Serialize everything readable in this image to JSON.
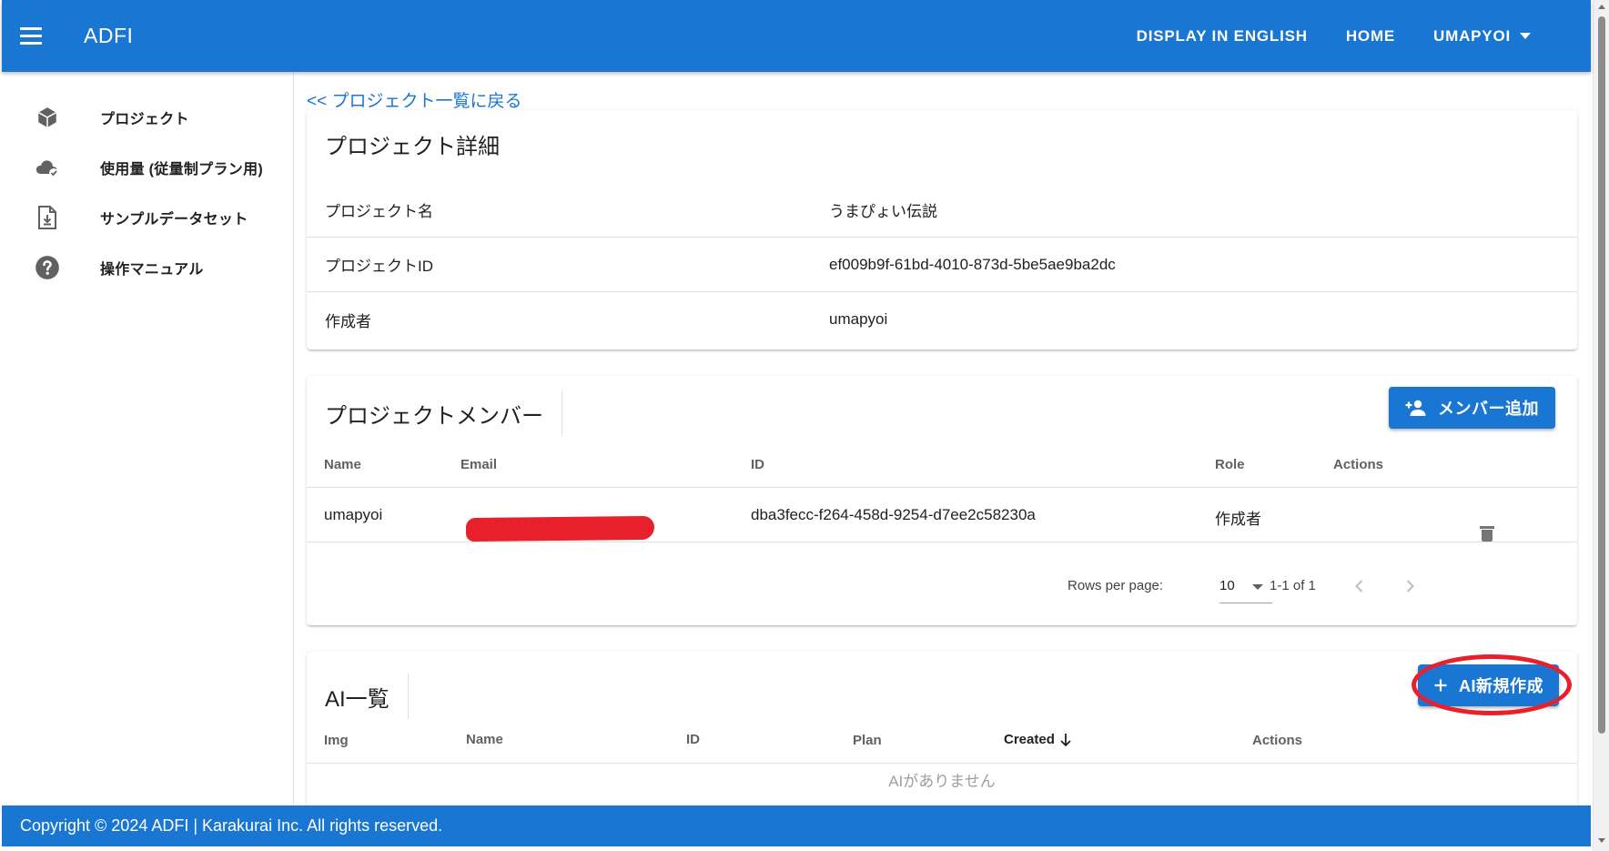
{
  "app": {
    "title": "ADFI",
    "nav": {
      "english": "DISPLAY IN ENGLISH",
      "home": "HOME",
      "user": "UMAPYOI"
    },
    "footer": "Copyright © 2024 ADFI | Karakurai Inc. All rights reserved."
  },
  "sidebar": {
    "items": [
      {
        "label": "プロジェクト",
        "icon": "cube-icon"
      },
      {
        "label": "使用量 (従量制プラン用)",
        "icon": "cloud-check-icon"
      },
      {
        "label": "サンプルデータセット",
        "icon": "file-download-icon"
      },
      {
        "label": "操作マニュアル",
        "icon": "help-circle-icon"
      }
    ]
  },
  "main": {
    "back_link": "<< プロジェクト一覧に戻る",
    "details": {
      "title": "プロジェクト詳細",
      "rows": [
        {
          "key": "プロジェクト名",
          "value": "うまぴょい伝説"
        },
        {
          "key": "プロジェクトID",
          "value": "ef009b9f-61bd-4010-873d-5be5ae9ba2dc"
        },
        {
          "key": "作成者",
          "value": "umapyoi"
        }
      ]
    },
    "members": {
      "title": "プロジェクトメンバー",
      "add_button": "メンバー追加",
      "columns": {
        "name": "Name",
        "email": "Email",
        "id": "ID",
        "role": "Role",
        "actions": "Actions"
      },
      "rows": [
        {
          "name": "umapyoi",
          "email": "",
          "id": "dba3fecc-f264-458d-9254-d7ee2c58230a",
          "role": "作成者"
        }
      ],
      "pagination": {
        "rows_per_page_label": "Rows per page:",
        "rows_per_page": "10",
        "range": "1-1 of 1"
      }
    },
    "ai_list": {
      "title": "AI一覧",
      "add_button": "AI新規作成",
      "columns": {
        "img": "Img",
        "name": "Name",
        "id": "ID",
        "plan": "Plan",
        "created": "Created",
        "actions": "Actions"
      },
      "empty": "AIがありません"
    }
  },
  "colors": {
    "primary": "#1976d2",
    "annotation": "#e8202c"
  }
}
